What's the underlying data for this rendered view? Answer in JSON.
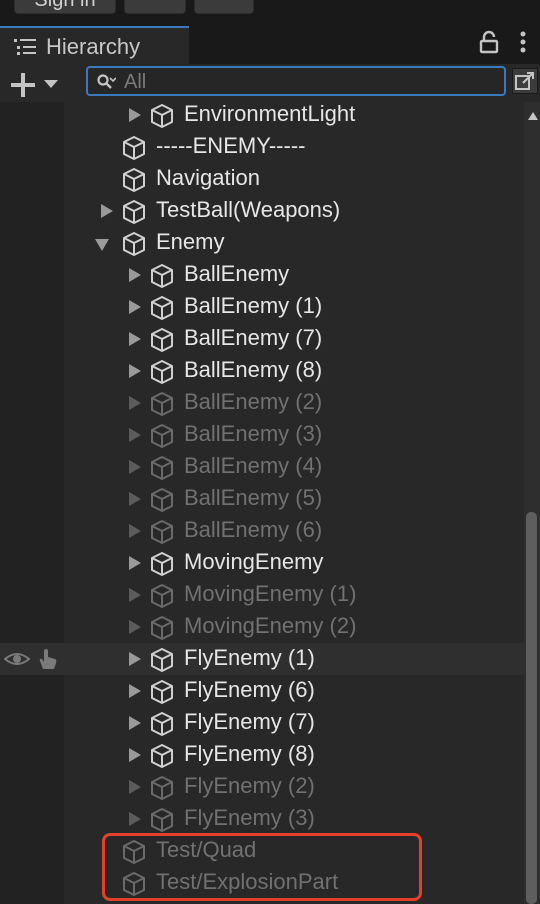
{
  "topbar": {
    "signin_label": "Sign in"
  },
  "tab": {
    "title": "Hierarchy",
    "icon": "hamburger-list-icon"
  },
  "search": {
    "placeholder": "All",
    "value": ""
  },
  "colors": {
    "accent": "#3a79bb",
    "highlight_border": "#e4412c",
    "active_text": "#e6e6e6",
    "inactive_text": "#717171"
  },
  "hierarchy": [
    {
      "label": "EnvironmentLight",
      "active": true
    },
    {
      "label": "-----ENEMY-----",
      "active": true
    },
    {
      "label": "Navigation",
      "active": true
    },
    {
      "label": "TestBall(Weapons)",
      "active": true
    },
    {
      "label": "Enemy",
      "active": true,
      "expanded": true
    },
    {
      "label": "BallEnemy",
      "active": true
    },
    {
      "label": "BallEnemy (1)",
      "active": true
    },
    {
      "label": "BallEnemy (7)",
      "active": true
    },
    {
      "label": "BallEnemy (8)",
      "active": true
    },
    {
      "label": "BallEnemy (2)",
      "active": false
    },
    {
      "label": "BallEnemy (3)",
      "active": false
    },
    {
      "label": "BallEnemy (4)",
      "active": false
    },
    {
      "label": "BallEnemy (5)",
      "active": false
    },
    {
      "label": "BallEnemy (6)",
      "active": false
    },
    {
      "label": "MovingEnemy",
      "active": true
    },
    {
      "label": "MovingEnemy (1)",
      "active": false
    },
    {
      "label": "MovingEnemy (2)",
      "active": false
    },
    {
      "label": "FlyEnemy (1)",
      "active": true,
      "hovered": true
    },
    {
      "label": "FlyEnemy (6)",
      "active": true
    },
    {
      "label": "FlyEnemy (7)",
      "active": true
    },
    {
      "label": "FlyEnemy (8)",
      "active": true
    },
    {
      "label": "FlyEnemy (2)",
      "active": false
    },
    {
      "label": "FlyEnemy (3)",
      "active": false
    },
    {
      "label": "Test/Quad",
      "active": false
    },
    {
      "label": "Test/ExplosionPart",
      "active": false
    }
  ]
}
